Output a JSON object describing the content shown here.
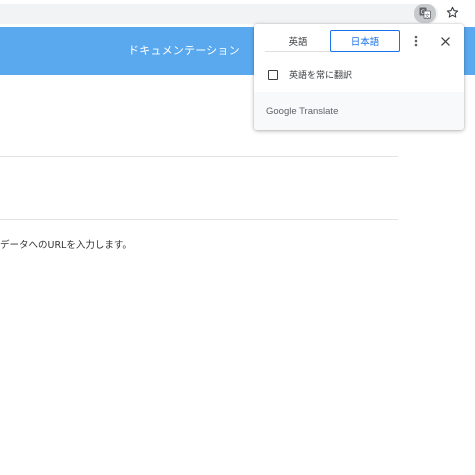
{
  "toolbar": {
    "translate_icon": "translate-icon",
    "star_icon": "star-icon"
  },
  "page": {
    "header_title": "ドキュメンテーション",
    "help_text": "データへのURLを入力します。"
  },
  "translate_popup": {
    "tabs": [
      {
        "label": "英語",
        "selected": false
      },
      {
        "label": "日本語",
        "selected": true
      }
    ],
    "menu_icon": "more-vert-icon",
    "close_icon": "close-icon",
    "always_translate_label": "英語を常に翻訳",
    "always_translate_checked": false,
    "brand": "Google Translate"
  },
  "colors": {
    "header_blue": "#5aa9ef",
    "selected_tab": "#1a73e8"
  }
}
